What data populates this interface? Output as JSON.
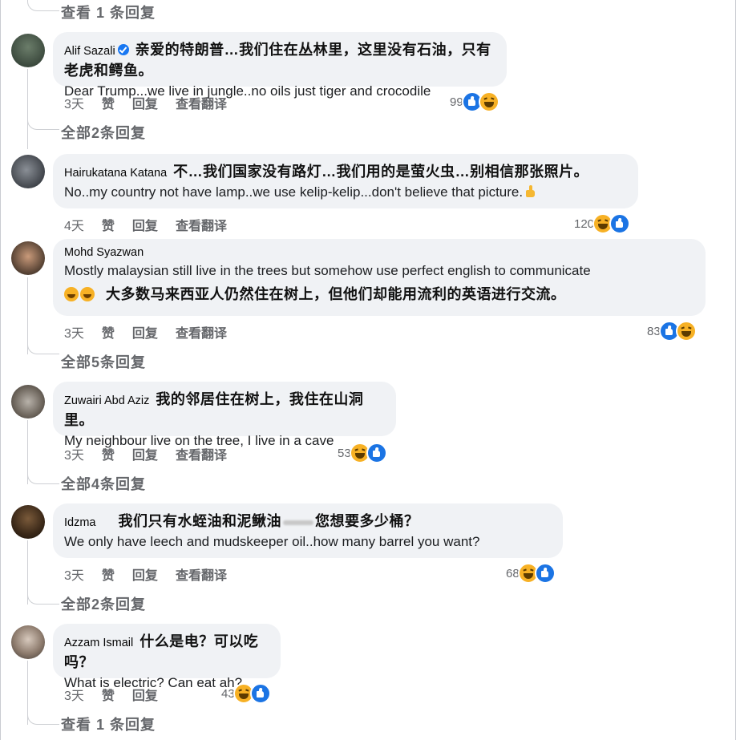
{
  "top_reply_link": "查看 1 条回复",
  "actions": {
    "like": "赞",
    "reply": "回复",
    "translate": "查看翻译"
  },
  "comments": [
    {
      "name": "Alif Sazali",
      "verified": true,
      "zh": "亲爱的特朗普…我们住在丛林里，这里没有石油，只有老虎和鳄鱼。",
      "en": "Dear Trump...we live in jungle..no oils just tiger and crocodile",
      "time": "3天",
      "show_translate": true,
      "count": "99",
      "reactions": [
        "like",
        "haha"
      ],
      "replies": "全部2条回复"
    },
    {
      "name": "Hairukatana Katana",
      "zh": "不…我们国家没有路灯…我们用的是萤火虫…别相信那张照片。",
      "en": "No..my country not have lamp..we use kelip-kelip...don't believe that picture.",
      "time": "4天",
      "show_translate": true,
      "count": "120",
      "reactions": [
        "haha",
        "like"
      ]
    },
    {
      "name": "Mohd Syazwan",
      "en": "Mostly malaysian still live in the trees but somehow use perfect english to communicate",
      "zh": "大多数马来西亚人仍然住在树上，但他们却能用流利的英语进行交流。",
      "time": "3天",
      "show_translate": true,
      "count": "83",
      "reactions": [
        "like",
        "haha"
      ],
      "replies": "全部5条回复"
    },
    {
      "name": "Zuwairi Abd Aziz",
      "zh": "我的邻居住在树上，我住在山洞里。",
      "en": "My neighbour live on the tree, I live in a cave",
      "time": "3天",
      "show_translate": true,
      "count": "53",
      "reactions": [
        "haha",
        "like"
      ],
      "replies": "全部4条回复"
    },
    {
      "name": "Idzma",
      "zh_a": "我们只有水蛭油和泥鳅油",
      "zh_b": "您想要多少桶？",
      "en": "We only have leech and mudskeeper oil..how many barrel you want?",
      "time": "3天",
      "show_translate": true,
      "count": "68",
      "reactions": [
        "haha",
        "like"
      ],
      "replies": "全部2条回复"
    },
    {
      "name": "Azzam Ismail",
      "zh": "什么是电？可以吃吗？",
      "en": "What is electric? Can eat ah?",
      "time": "3天",
      "show_translate": false,
      "count": "43",
      "reactions": [
        "haha",
        "like"
      ],
      "replies": "查看 1 条回复"
    }
  ]
}
